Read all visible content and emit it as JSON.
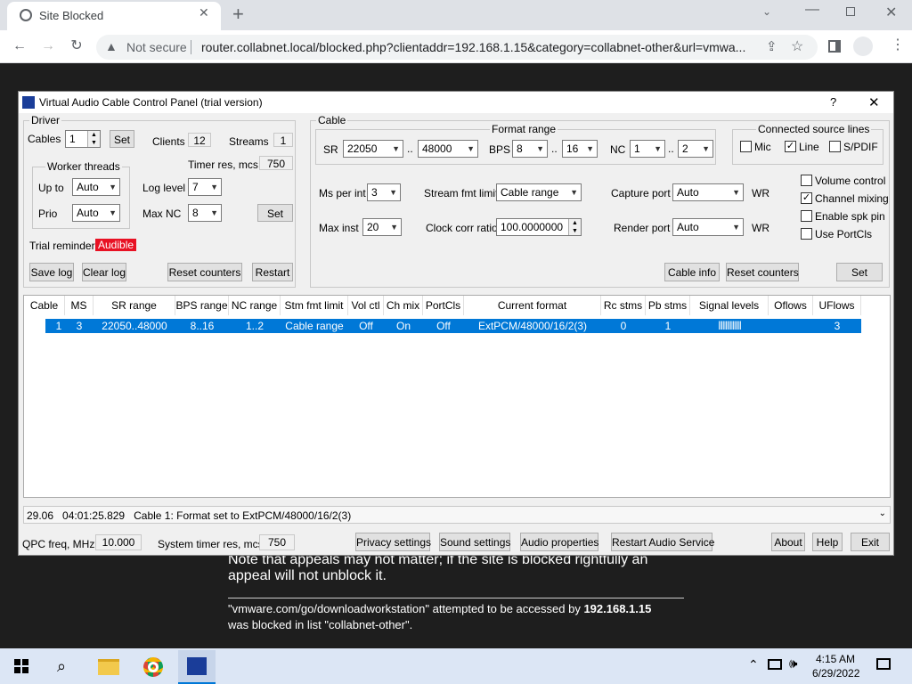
{
  "browser": {
    "tab_title": "Site Blocked",
    "not_secure": "Not secure",
    "url": "router.collabnet.local/blocked.php?clientaddr=192.168.1.15&category=collabnet-other&url=vmwa..."
  },
  "page": {
    "para1": "Note that appeals may not matter; if the site is blocked rightfully an",
    "para2": "appeal will not unblock it.",
    "blocked_q": "\"vmware.com/go/downloadworkstation\" attempted to be accessed by ",
    "blocked_ip": "192.168.1.15",
    "blocked_list": "was blocked in list \"collabnet-other\"."
  },
  "dialog": {
    "title": "Virtual Audio Cable Control Panel (trial version)",
    "help": "?",
    "close": "✕",
    "driver": {
      "group": "Driver",
      "cables_label": "Cables",
      "cables_value": "1",
      "set": "Set",
      "clients_label": "Clients",
      "clients_value": "12",
      "streams_label": "Streams",
      "streams_value": "1",
      "worker_group": "Worker threads",
      "upto_label": "Up to",
      "upto_value": "Auto",
      "prio_label": "Prio",
      "prio_value": "Auto",
      "timer_label": "Timer res, mcs",
      "timer_value": "750",
      "loglevel_label": "Log level",
      "loglevel_value": "7",
      "maxnc_label": "Max NC",
      "maxnc_value": "8",
      "set2": "Set",
      "trial_label": "Trial reminder",
      "trial_badge": "Audible",
      "save_log": "Save log",
      "clear_log": "Clear log",
      "reset_counters": "Reset counters",
      "restart": "Restart"
    },
    "cable": {
      "group": "Cable",
      "format_range": "Format range",
      "sr_label": "SR",
      "sr_min": "22050",
      "sr_max": "48000",
      "dots": "..",
      "bps_label": "BPS",
      "bps_min": "8",
      "bps_max": "16",
      "nc_label": "NC",
      "nc_min": "1",
      "nc_max": "2",
      "ms_label": "Ms per int",
      "ms_value": "3",
      "sfl_label": "Stream fmt limit",
      "sfl_value": "Cable range",
      "cap_label": "Capture port",
      "cap_value": "Auto",
      "wr": "WR",
      "maxinst_label": "Max inst",
      "maxinst_value": "20",
      "ccr_label": "Clock corr ratio",
      "ccr_value": "100.0000000",
      "ren_label": "Render port",
      "ren_value": "Auto",
      "csl_group": "Connected source lines",
      "mic": "Mic",
      "line": "Line",
      "spdif": "S/PDIF",
      "vol_control": "Volume control",
      "channel_mixing": "Channel mixing",
      "enable_spk": "Enable spk pin",
      "use_portcls": "Use PortCls",
      "cable_info": "Cable info",
      "reset_counters": "Reset counters",
      "set": "Set"
    },
    "table": {
      "headers": [
        "Cable",
        "MS",
        "SR range",
        "BPS range",
        "NC range",
        "Stm fmt limit",
        "Vol ctl",
        "Ch mix",
        "PortCls",
        "Current format",
        "Rc stms",
        "Pb stms",
        "Signal levels",
        "Oflows",
        "UFlows"
      ],
      "row": [
        "1",
        "3",
        "22050..48000",
        "8..16",
        "1..2",
        "Cable range",
        "Off",
        "On",
        "Off",
        "ExtPCM/48000/16/2(3)",
        "0",
        "1",
        "||||||||||||||||",
        "",
        "3"
      ]
    },
    "log_line": "29.06   04:01:25.829   Cable 1: Format set to ExtPCM/48000/16/2(3)",
    "qpc_label": "QPC freq, MHz",
    "qpc_value": "10.000",
    "systimer_label": "System timer res, mcs",
    "systimer_value": "750",
    "privacy": "Privacy settings",
    "sound": "Sound settings",
    "audio_props": "Audio properties",
    "restart_audio": "Restart Audio Service",
    "about": "About",
    "help_btn": "Help",
    "exit": "Exit"
  },
  "taskbar": {
    "time": "4:15 AM",
    "date": "6/29/2022"
  }
}
